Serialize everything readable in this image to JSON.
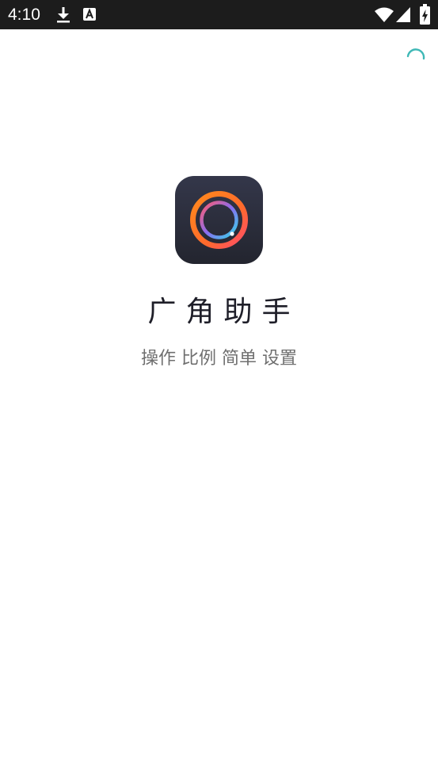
{
  "status_bar": {
    "time": "4:10",
    "left_icons": [
      "download-icon",
      "a-notification-icon"
    ],
    "right_icons": [
      "wifi-icon",
      "signal-icon",
      "battery-icon"
    ],
    "background": "#1c1c1c"
  },
  "loading": {
    "icon": "loading-spinner-icon",
    "color": "#3fb8b6"
  },
  "app": {
    "icon": "app-logo-icon",
    "title": "广角助手",
    "tagline": "操作 比例 简单 设置",
    "icon_bg": "#2c2e3e",
    "ring_colors": [
      "#ff7a1a",
      "#ff4d6a",
      "#34d6e8"
    ]
  }
}
